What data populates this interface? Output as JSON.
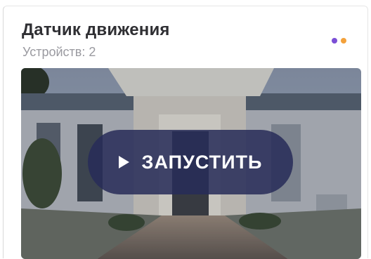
{
  "card": {
    "title": "Датчик движения",
    "subtitle": "Устройств: 2"
  },
  "status_dots": [
    "#7b4fd6",
    "#f3a13b"
  ],
  "preview": {
    "button_label": "ЗАПУСТИТЬ",
    "button_icon": "play-icon"
  }
}
